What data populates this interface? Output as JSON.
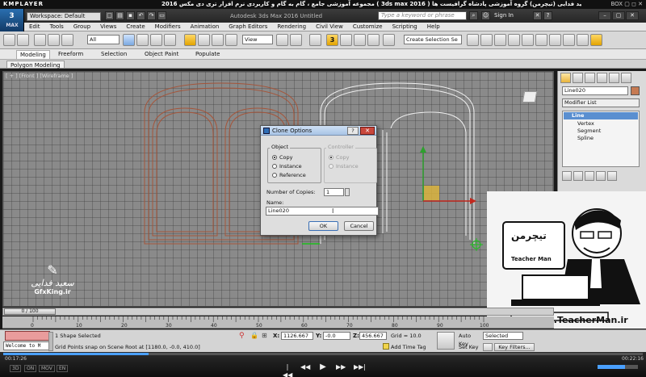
{
  "player": {
    "brand": "KMPLAYER",
    "title": "مجموعه آموزشی جامع ، گام به گام و کاربردی نرم افزار تری دی مکس 2016 ( 3ds max 2016 )  مدرس : سعید فدایی (تیچرمن) گروه آموزشی پادشاه گرافیست ها",
    "controls": "BOX ▢ ◻ ✕",
    "elapsed": "00:17:26",
    "total": "00:22:16",
    "buttons": [
      "|◀◀",
      "◀◀",
      "▶",
      "▶▶",
      "▶▶|"
    ],
    "left_tags": [
      "3D",
      "ON",
      "MOV",
      "EN"
    ]
  },
  "app": {
    "logo": "3",
    "logo_sub": "MAX",
    "workspace": "Workspace: Default",
    "title": "Autodesk 3ds Max 2016    Untitled",
    "search_placeholder": "Type a keyword or phrase",
    "signin": "Sign In",
    "window_controls": [
      "–",
      "▢",
      "✕"
    ]
  },
  "menu": [
    "Edit",
    "Tools",
    "Group",
    "Views",
    "Create",
    "Modifiers",
    "Animation",
    "Graph Editors",
    "Rendering",
    "Civil View",
    "Customize",
    "Scripting",
    "Help"
  ],
  "toolbar": {
    "filter": "All",
    "refcoord": "View",
    "snap_label": "3",
    "selection_set": "Create Selection Se"
  },
  "ribbon": {
    "tabs": [
      "Modeling",
      "Freeform",
      "Selection",
      "Object Paint",
      "Populate"
    ],
    "sub_tab": "Polygon Modeling"
  },
  "viewport": {
    "label": "[ + ] [Front ] [Wireframe ]"
  },
  "command_panel": {
    "object_name": "Line020",
    "object_color": "#c67a52",
    "modifier_list": "Modifier List",
    "stack": [
      "Line",
      "Vertex",
      "Segment",
      "Spline"
    ]
  },
  "dialog": {
    "title": "Clone Options",
    "help": "?",
    "close": "✕",
    "object_group": "Object",
    "object_options": [
      "Copy",
      "Instance",
      "Reference"
    ],
    "controller_group": "Controller",
    "controller_options": [
      "Copy",
      "Instance"
    ],
    "copies_label": "Number of Copies:",
    "copies_value": "1",
    "name_label": "Name:",
    "name_value": "Line020",
    "ok": "OK",
    "cancel": "Cancel"
  },
  "timeline": {
    "frame": "0 / 100",
    "ticks": [
      "0",
      "10",
      "20",
      "30",
      "40",
      "50",
      "60",
      "70",
      "80",
      "90",
      "100"
    ]
  },
  "status": {
    "maxscript": "Welcome to M",
    "line1": "1 Shape Selected",
    "line2": "Grid Points snap on Scene Root at [1180.0, -0.0, 410.0]",
    "x_label": "X:",
    "x": "1126.667",
    "y_label": "Y:",
    "y": "-0.0",
    "z_label": "Z:",
    "z": "456.667",
    "grid": "Grid = 10.0",
    "add_time_tag": "Add Time Tag",
    "auto_key": "Auto Key",
    "set_key": "Set Key",
    "selected": "Selected",
    "key_filters": "Key Filters..."
  },
  "watermark": {
    "left_name": "سعید فدایی",
    "left_url": "GfxKing.ir",
    "card_title": "تیچرمن",
    "card_sub": "Teacher Man",
    "url": "www.TeacherMan.ir"
  }
}
